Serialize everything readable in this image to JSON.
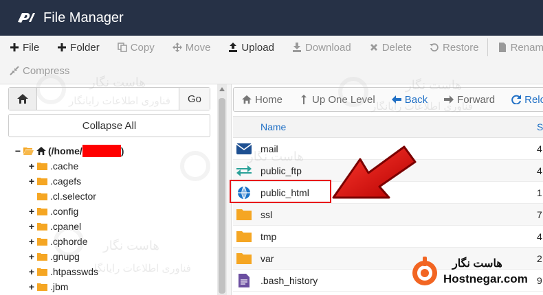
{
  "app": {
    "title": "File Manager"
  },
  "toolbar": {
    "row1": [
      {
        "key": "file",
        "label": "File",
        "icon": "plus-icon",
        "disabled": false
      },
      {
        "key": "folder",
        "label": "Folder",
        "icon": "plus-icon",
        "disabled": false
      },
      {
        "key": "copy",
        "label": "Copy",
        "icon": "copy-icon",
        "disabled": true
      },
      {
        "key": "move",
        "label": "Move",
        "icon": "move-icon",
        "disabled": true
      },
      {
        "key": "upload",
        "label": "Upload",
        "icon": "upload-icon",
        "disabled": false
      },
      {
        "key": "download",
        "label": "Download",
        "icon": "download-icon",
        "disabled": true
      },
      {
        "key": "delete",
        "label": "Delete",
        "icon": "close-icon",
        "disabled": true
      },
      {
        "key": "restore",
        "label": "Restore",
        "icon": "restore-icon",
        "disabled": true
      },
      {
        "key": "rename",
        "label": "Rename",
        "icon": "file-icon",
        "disabled": true
      }
    ],
    "row2": [
      {
        "key": "compress",
        "label": "Compress",
        "icon": "compress-icon",
        "disabled": true
      }
    ]
  },
  "left": {
    "path_value": "",
    "go_label": "Go",
    "collapse_label": "Collapse All",
    "root_prefix": "(/home/",
    "root_suffix": ")",
    "tree": [
      {
        "name": ".cache",
        "expand": true
      },
      {
        "name": ".cagefs",
        "expand": true
      },
      {
        "name": ".cl.selector",
        "expand": false
      },
      {
        "name": ".config",
        "expand": true
      },
      {
        "name": ".cpanel",
        "expand": true
      },
      {
        "name": ".cphorde",
        "expand": true
      },
      {
        "name": ".gnupg",
        "expand": true
      },
      {
        "name": ".htpasswds",
        "expand": true
      },
      {
        "name": ".jbm",
        "expand": true
      }
    ]
  },
  "right": {
    "nav": [
      {
        "key": "home",
        "label": "Home",
        "icon": "home-icon",
        "style": "grey"
      },
      {
        "key": "up",
        "label": "Up One Level",
        "icon": "level-up-icon",
        "style": "grey"
      },
      {
        "key": "back",
        "label": "Back",
        "icon": "arrow-left-icon",
        "style": "blue"
      },
      {
        "key": "forward",
        "label": "Forward",
        "icon": "arrow-right-icon",
        "style": "grey"
      },
      {
        "key": "reload",
        "label": "Reload",
        "icon": "reload-icon",
        "style": "blue"
      }
    ],
    "columns": {
      "name": "Name",
      "size": "S"
    },
    "files": [
      {
        "name": "mail",
        "icon": "mail-icon",
        "size": "4"
      },
      {
        "name": "public_ftp",
        "icon": "transfer-icon",
        "size": "4"
      },
      {
        "name": "public_html",
        "icon": "globe-icon",
        "size": "1"
      },
      {
        "name": "ssl",
        "icon": "folder-icon",
        "size": "7"
      },
      {
        "name": "tmp",
        "icon": "folder-icon",
        "size": "4"
      },
      {
        "name": "var",
        "icon": "folder-icon",
        "size": "2"
      },
      {
        "name": ".bash_history",
        "icon": "text-file-icon",
        "size": "9"
      }
    ]
  },
  "watermark": {
    "fa_title": "هاست نگار",
    "fa_sub": "فناوری اطلاعات رایانگار"
  },
  "brand": {
    "fa": "هاست نگار",
    "en": "Hostnegar.com"
  },
  "colors": {
    "header": "#263146",
    "link": "#1f6fc5",
    "highlight": "#e8141a",
    "folder": "#f5a623",
    "brand": "#f26522"
  }
}
